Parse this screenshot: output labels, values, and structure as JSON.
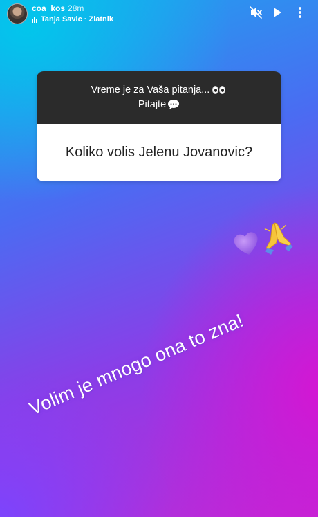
{
  "header": {
    "username": "coa_kos",
    "time": "28m",
    "music": "Tanja Savic · Zlatnik"
  },
  "question_card": {
    "prompt_line1": "Vreme je za Vaša pitanja...",
    "prompt_line2": "Pitajte",
    "question": "Koliko volis Jelenu Jovanovic?"
  },
  "answer": {
    "text": "Volim je mnogo ona to zna!"
  },
  "icons": [
    "mute-icon",
    "play-icon",
    "more-options-icon",
    "eyes-emoji-icon",
    "speech-bubble-icon",
    "purple-heart-icon",
    "praying-hands-icon"
  ]
}
